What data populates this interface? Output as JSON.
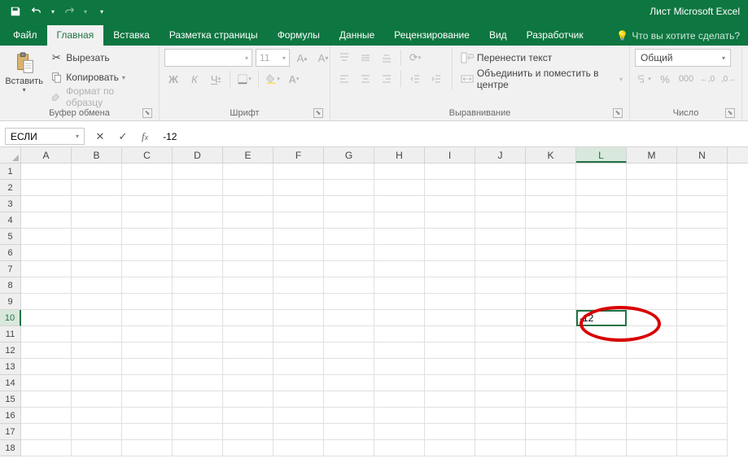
{
  "title": "Лист Microsoft Excel",
  "tabs": {
    "file": "Файл",
    "home": "Главная",
    "insert": "Вставка",
    "page_layout": "Разметка страницы",
    "formulas": "Формулы",
    "data": "Данные",
    "review": "Рецензирование",
    "view": "Вид",
    "developer": "Разработчик"
  },
  "tell_me": "Что вы хотите сделать?",
  "ribbon": {
    "clipboard": {
      "paste": "Вставить",
      "cut": "Вырезать",
      "copy": "Копировать",
      "format_painter": "Формат по образцу",
      "label": "Буфер обмена"
    },
    "font": {
      "name": "",
      "size": "11",
      "label": "Шрифт"
    },
    "alignment": {
      "wrap": "Перенести текст",
      "merge": "Объединить и поместить в центре",
      "label": "Выравнивание"
    },
    "number": {
      "format": "Общий",
      "label": "Число"
    }
  },
  "namebox": "ЕСЛИ",
  "formula": "-12",
  "columns": [
    "A",
    "B",
    "C",
    "D",
    "E",
    "F",
    "G",
    "H",
    "I",
    "J",
    "K",
    "L",
    "M",
    "N"
  ],
  "rows": [
    1,
    2,
    3,
    4,
    5,
    6,
    7,
    8,
    9,
    10,
    11,
    12,
    13,
    14,
    15,
    16,
    17,
    18
  ],
  "active": {
    "col": "L",
    "row": 10,
    "value": "-12"
  }
}
